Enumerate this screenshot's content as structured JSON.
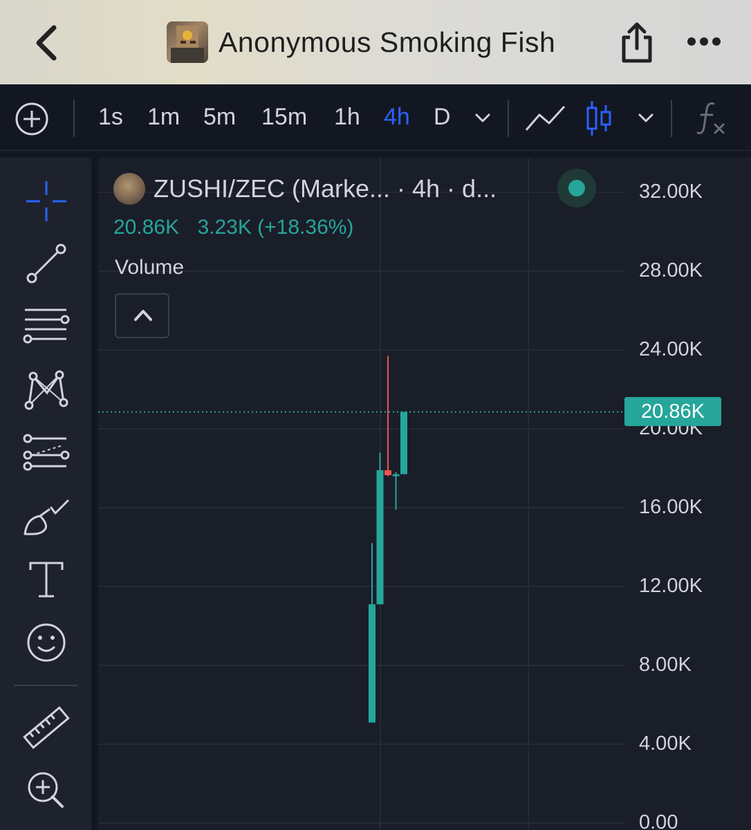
{
  "header": {
    "title": "Anonymous Smoking Fish",
    "back_icon": "chevron-left-icon",
    "share_icon": "share-icon",
    "more_icon": "ellipsis-icon"
  },
  "toolbar": {
    "add_icon": "plus-circle-icon",
    "timeframes": [
      "1s",
      "1m",
      "5m",
      "15m",
      "1h",
      "4h",
      "D"
    ],
    "active_timeframe": "4h",
    "chart_type_icon": "candlestick-icon",
    "line_icon": "line-chart-icon",
    "indicators_icon": "fx-icon"
  },
  "sidebar": {
    "tools": [
      "crosshair-icon",
      "trend-line-icon",
      "horizontal-lines-icon",
      "pattern-icon",
      "fib-icon",
      "brush-icon",
      "text-icon",
      "emoji-icon",
      "ruler-icon",
      "zoom-in-icon"
    ]
  },
  "legend": {
    "symbol": "ZUSHI/ZEC (Marke... · 4h · d...",
    "last": "20.86K",
    "change": "3.23K (+18.36%)",
    "volume_label": "Volume"
  },
  "colors": {
    "up": "#26a69a",
    "down": "#ef5350",
    "accent": "#2962ff",
    "background": "#131722"
  },
  "chart_data": {
    "type": "candlestick",
    "y_ticks": [
      "32.00K",
      "28.00K",
      "24.00K",
      "20.00K",
      "16.00K",
      "12.00K",
      "8.00K",
      "4.00K",
      "0.00"
    ],
    "ylim": [
      0,
      32000
    ],
    "last_price": 20860,
    "last_price_label": "20.86K",
    "candles": [
      {
        "open": 5100,
        "high": 14200,
        "low": 5100,
        "close": 11100
      },
      {
        "open": 11100,
        "high": 18800,
        "low": 11100,
        "close": 17900
      },
      {
        "open": 17900,
        "high": 23700,
        "low": 17600,
        "close": 17650
      },
      {
        "open": 17650,
        "high": 17800,
        "low": 15900,
        "close": 17700
      },
      {
        "open": 17700,
        "high": 20860,
        "low": 17700,
        "close": 20860
      }
    ]
  }
}
